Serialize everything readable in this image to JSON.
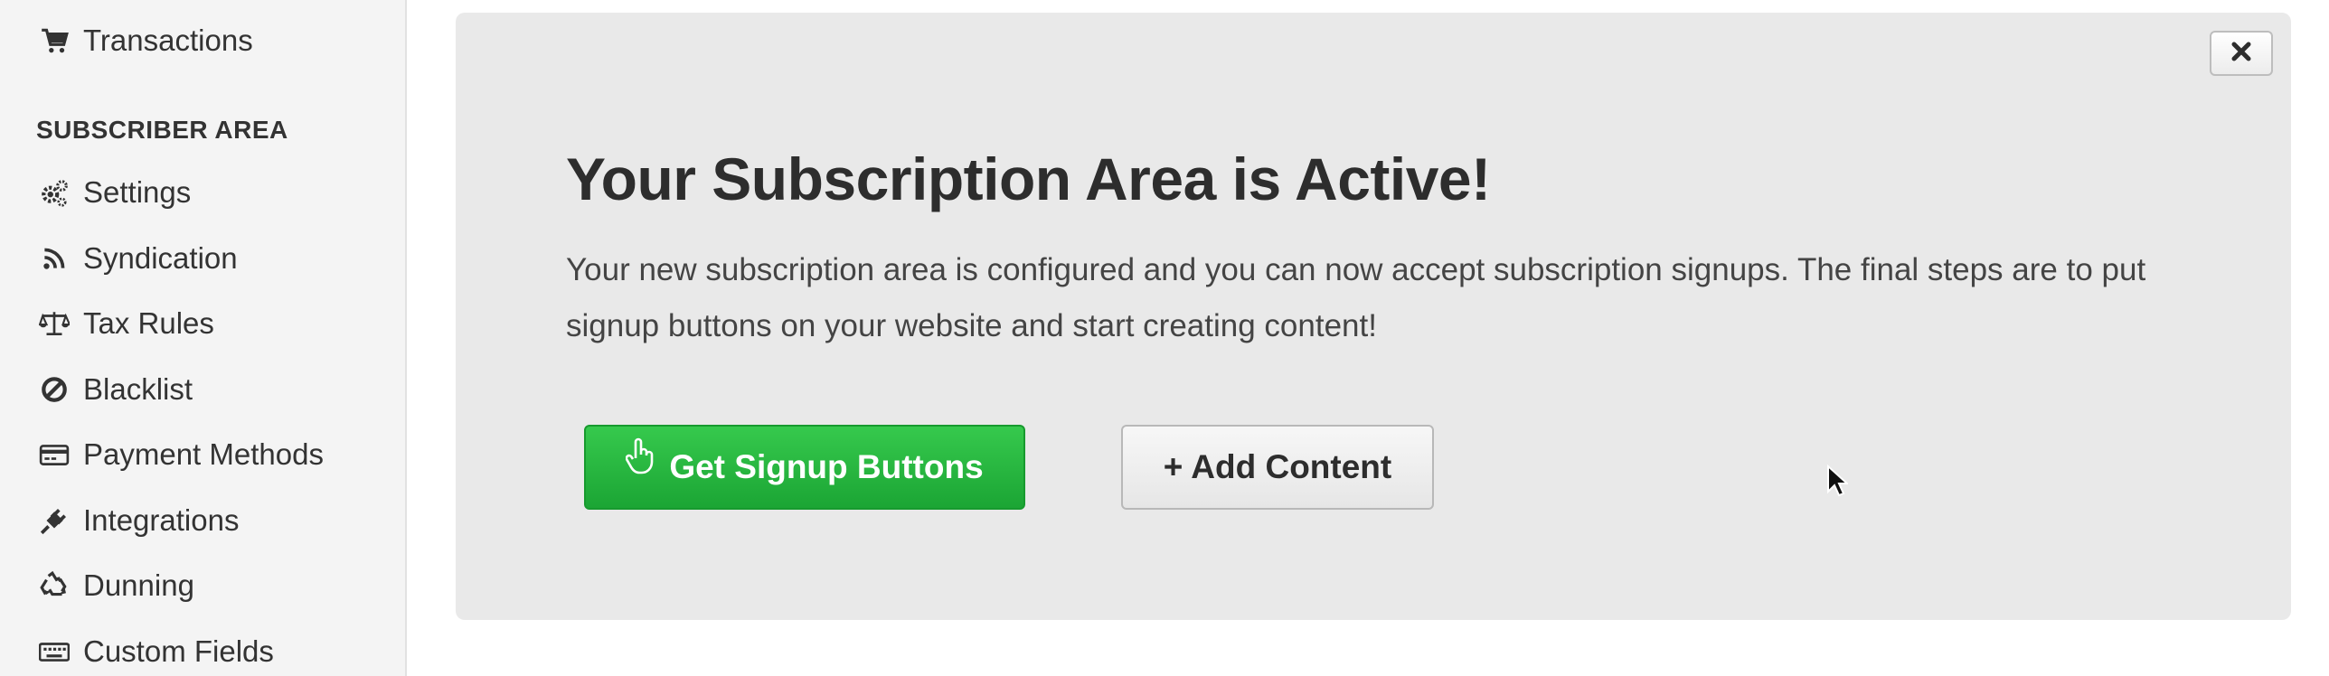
{
  "sidebar": {
    "top_item": {
      "label": "Transactions",
      "icon": "cart-icon"
    },
    "section_header": "SUBSCRIBER AREA",
    "items": [
      {
        "label": "Settings",
        "icon": "gears-icon"
      },
      {
        "label": "Syndication",
        "icon": "rss-icon"
      },
      {
        "label": "Tax Rules",
        "icon": "scale-icon"
      },
      {
        "label": "Blacklist",
        "icon": "ban-icon"
      },
      {
        "label": "Payment Methods",
        "icon": "credit-card-icon"
      },
      {
        "label": "Integrations",
        "icon": "plug-icon"
      },
      {
        "label": "Dunning",
        "icon": "recycle-icon"
      },
      {
        "label": "Custom Fields",
        "icon": "keyboard-icon"
      }
    ]
  },
  "panel": {
    "title": "Your Subscription Area is Active!",
    "description": "Your new subscription area is configured and you can now accept subscription signups. The final steps are to put signup buttons on your website and start creating content!",
    "primary_button": "Get Signup Buttons",
    "secondary_button": "+ Add Content",
    "close_icon": "close-icon"
  },
  "colors": {
    "sidebar_bg": "#f4f4f4",
    "panel_bg": "#e9e9e9",
    "primary_green": "#22b33b",
    "text_dark": "#2d2d2d"
  }
}
